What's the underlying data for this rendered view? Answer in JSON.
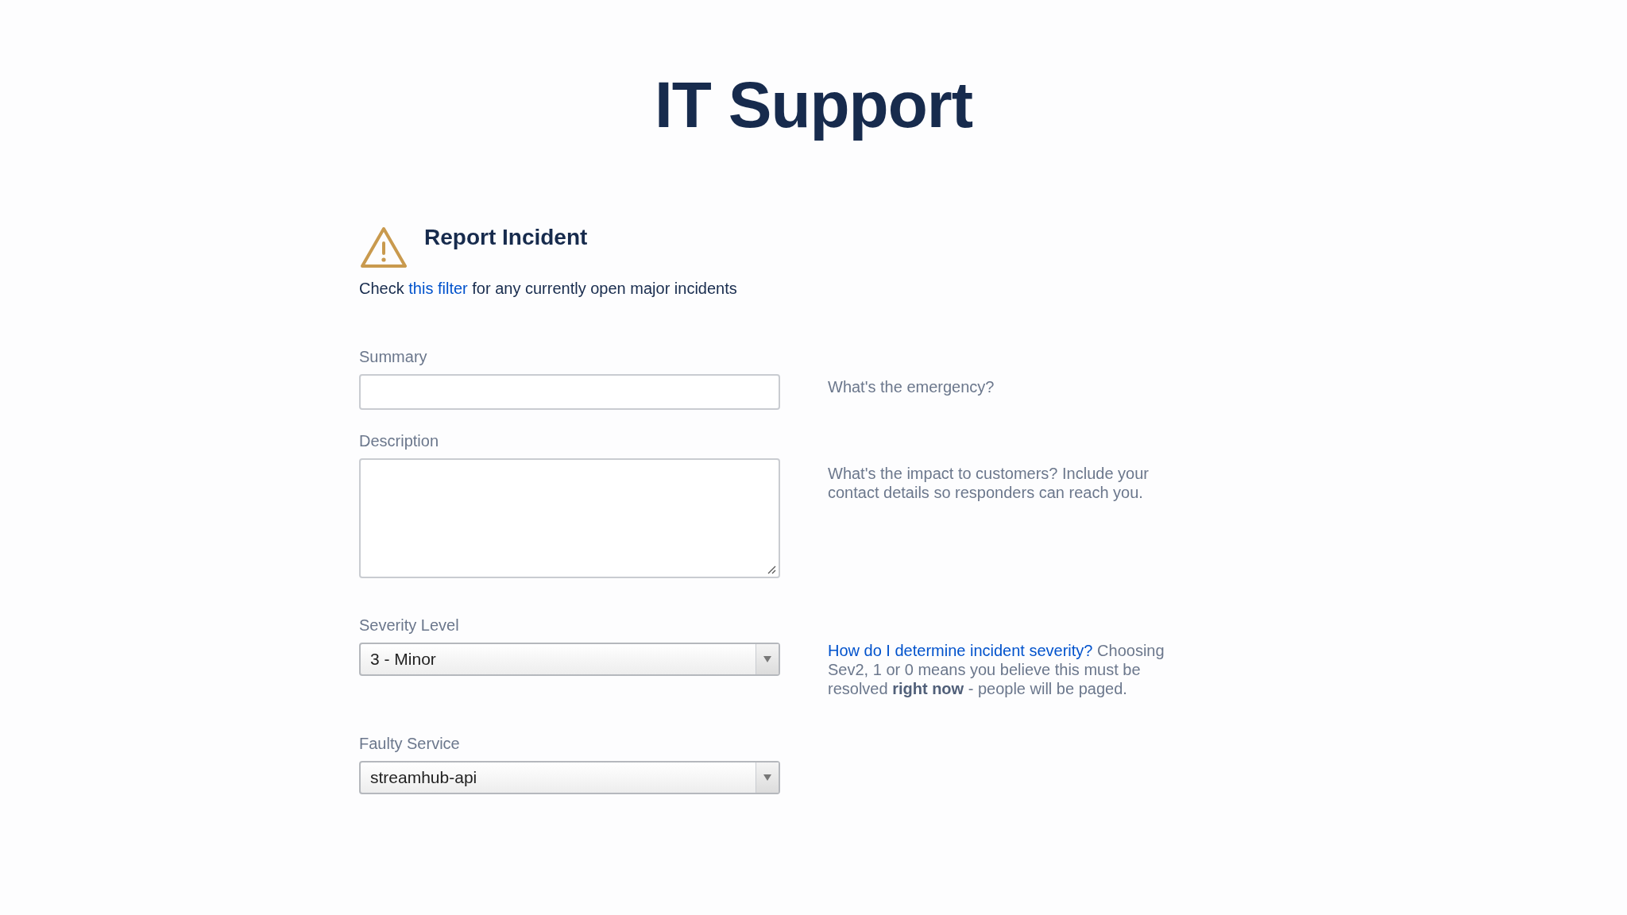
{
  "page": {
    "title": "IT Support"
  },
  "form": {
    "title": "Report Incident",
    "intro": {
      "prefix": "Check",
      "link": "this filter",
      "suffix": "for any currently open major incidents"
    }
  },
  "fields": [
    {
      "kind": "text",
      "label": "Summary",
      "help": {
        "text": "What's the emergency?"
      }
    },
    {
      "kind": "textarea",
      "label": "Description",
      "help": {
        "text": "What's the impact to customers? Include your contact details so responders can reach you."
      }
    },
    {
      "kind": "select",
      "label": "Severity Level",
      "value": "3 - Minor",
      "help": {
        "link": "How do I determine incident severity?",
        "text": "Choosing Sev2, 1 or 0 means you believe this must be resolved **right now** - people will be paged."
      }
    },
    {
      "kind": "select",
      "label": "Faulty Service",
      "value": "streamhub-api"
    }
  ]
}
